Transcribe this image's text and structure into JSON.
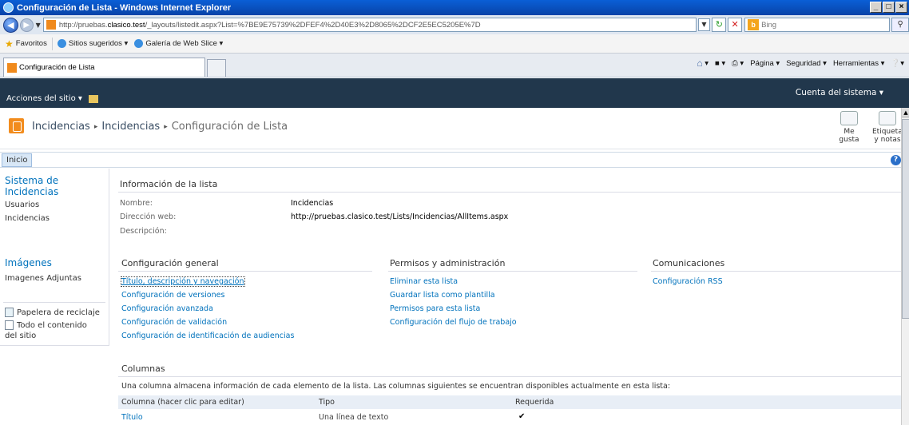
{
  "window": {
    "title": "Configuración de Lista - Windows Internet Explorer",
    "controls": [
      "_",
      "□",
      "×"
    ]
  },
  "address": {
    "url_prefix": "http://pruebas.",
    "url_host": "clasico.test",
    "url_rest": "/_layouts/listedit.aspx?List=%7BE9E75739%2DFEF4%2D40E3%2D8065%2DCF2E5EC5205E%7D",
    "search_placeholder": "Bing"
  },
  "favorites": {
    "label": "Favoritos",
    "items": [
      "Sitios sugeridos ▾",
      "Galería de Web Slice ▾"
    ]
  },
  "tab": {
    "title": "Configuración de Lista"
  },
  "commandbar": {
    "items": [
      "▾",
      "▾",
      "▾",
      "Página ▾",
      "Seguridad ▾",
      "Herramientas ▾",
      "▾"
    ]
  },
  "ribbon": {
    "site_actions": "Acciones del sitio ▾",
    "account": "Cuenta del sistema ▾"
  },
  "breadcrumb": {
    "items": [
      "Incidencias",
      "Incidencias"
    ],
    "current": "Configuración de Lista"
  },
  "social": {
    "like": "Me gusta",
    "tags_line1": "Etiquetas",
    "tags_line2": "y notas"
  },
  "topnav": {
    "home": "Inicio",
    "help": "?"
  },
  "leftnav": {
    "heading1_line1": "Sistema de",
    "heading1_line2": "Incidencias",
    "items1": [
      "Usuarios",
      "Incidencias"
    ],
    "heading2": "Imágenes",
    "items2": [
      "Imagenes Adjuntas"
    ],
    "recycle": "Papelera de reciclaje",
    "all_content_line1": "Todo el contenido",
    "all_content_line2": "del sitio"
  },
  "list_info": {
    "title": "Información de la lista",
    "name_label": "Nombre:",
    "name_value": "Incidencias",
    "url_label": "Dirección web:",
    "url_value": "http://pruebas.clasico.test/Lists/Incidencias/AllItems.aspx",
    "desc_label": "Descripción:"
  },
  "general": {
    "title": "Configuración general",
    "links": [
      "Título, descripción y navegación",
      "Configuración de versiones",
      "Configuración avanzada",
      "Configuración de validación",
      "Configuración de identificación de audiencias"
    ]
  },
  "permissions": {
    "title": "Permisos y administración",
    "links": [
      "Eliminar esta lista",
      "Guardar lista como plantilla",
      "Permisos para esta lista",
      "Configuración del flujo de trabajo"
    ]
  },
  "communications": {
    "title": "Comunicaciones",
    "links": [
      "Configuración RSS"
    ]
  },
  "columns": {
    "title": "Columnas",
    "description": "Una columna almacena información de cada elemento de la lista. Las columnas siguientes se encuentran disponibles actualmente en esta lista:",
    "headers": [
      "Columna (hacer clic para editar)",
      "Tipo",
      "Requerida"
    ],
    "rows": [
      {
        "name": "Título",
        "type": "Una línea de texto",
        "required": "✔"
      }
    ]
  }
}
